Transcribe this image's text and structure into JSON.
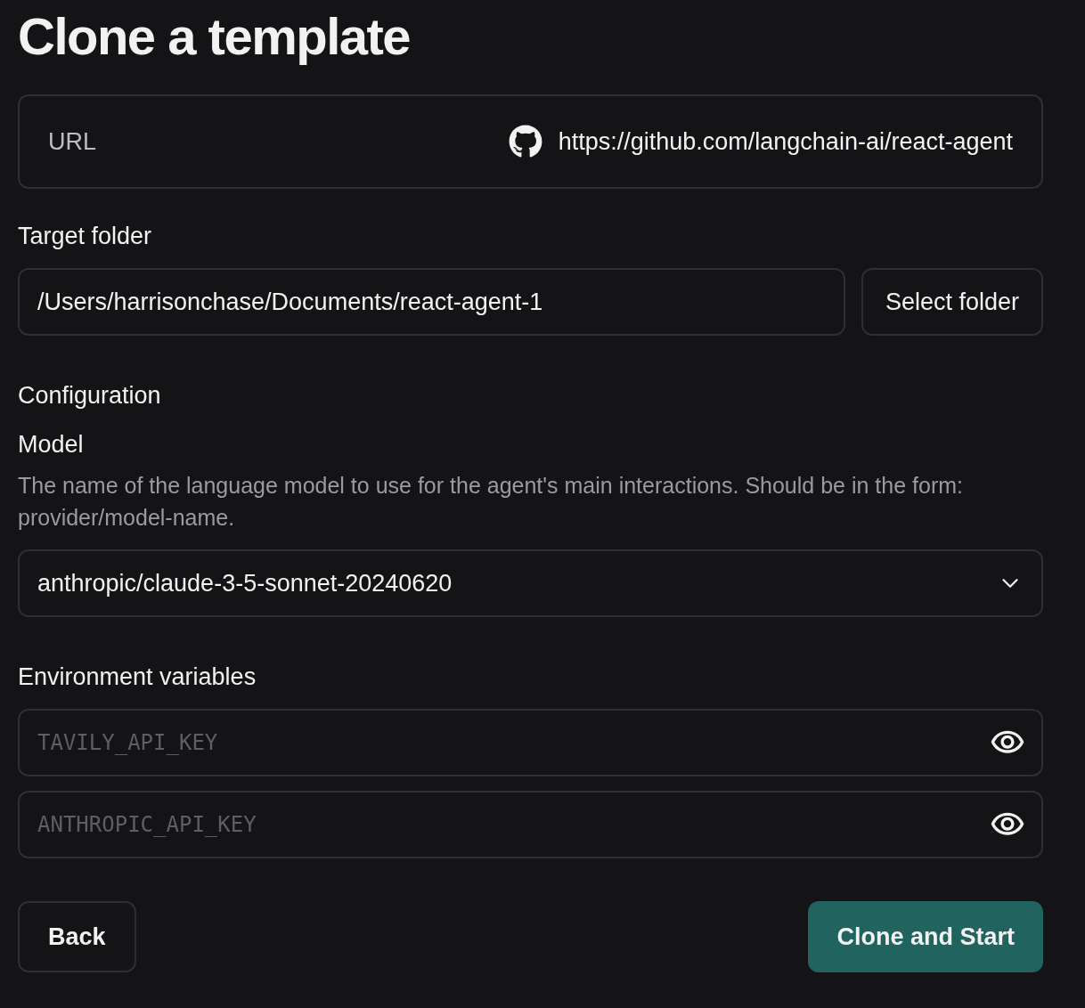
{
  "title": "Clone a template",
  "url": {
    "label": "URL",
    "value": "https://github.com/langchain-ai/react-agent"
  },
  "target_folder": {
    "label": "Target folder",
    "value": "/Users/harrisonchase/Documents/react-agent-1",
    "button": "Select folder"
  },
  "configuration": {
    "heading": "Configuration",
    "fields": [
      {
        "label": "Model",
        "description": "The name of the language model to use for the agent's main interactions. Should be in the form: provider/model-name.",
        "value": "anthropic/claude-3-5-sonnet-20240620"
      }
    ]
  },
  "environment": {
    "heading": "Environment variables",
    "variables": [
      {
        "placeholder": "TAVILY_API_KEY"
      },
      {
        "placeholder": "ANTHROPIC_API_KEY"
      }
    ]
  },
  "actions": {
    "back": "Back",
    "primary": "Clone and Start"
  }
}
